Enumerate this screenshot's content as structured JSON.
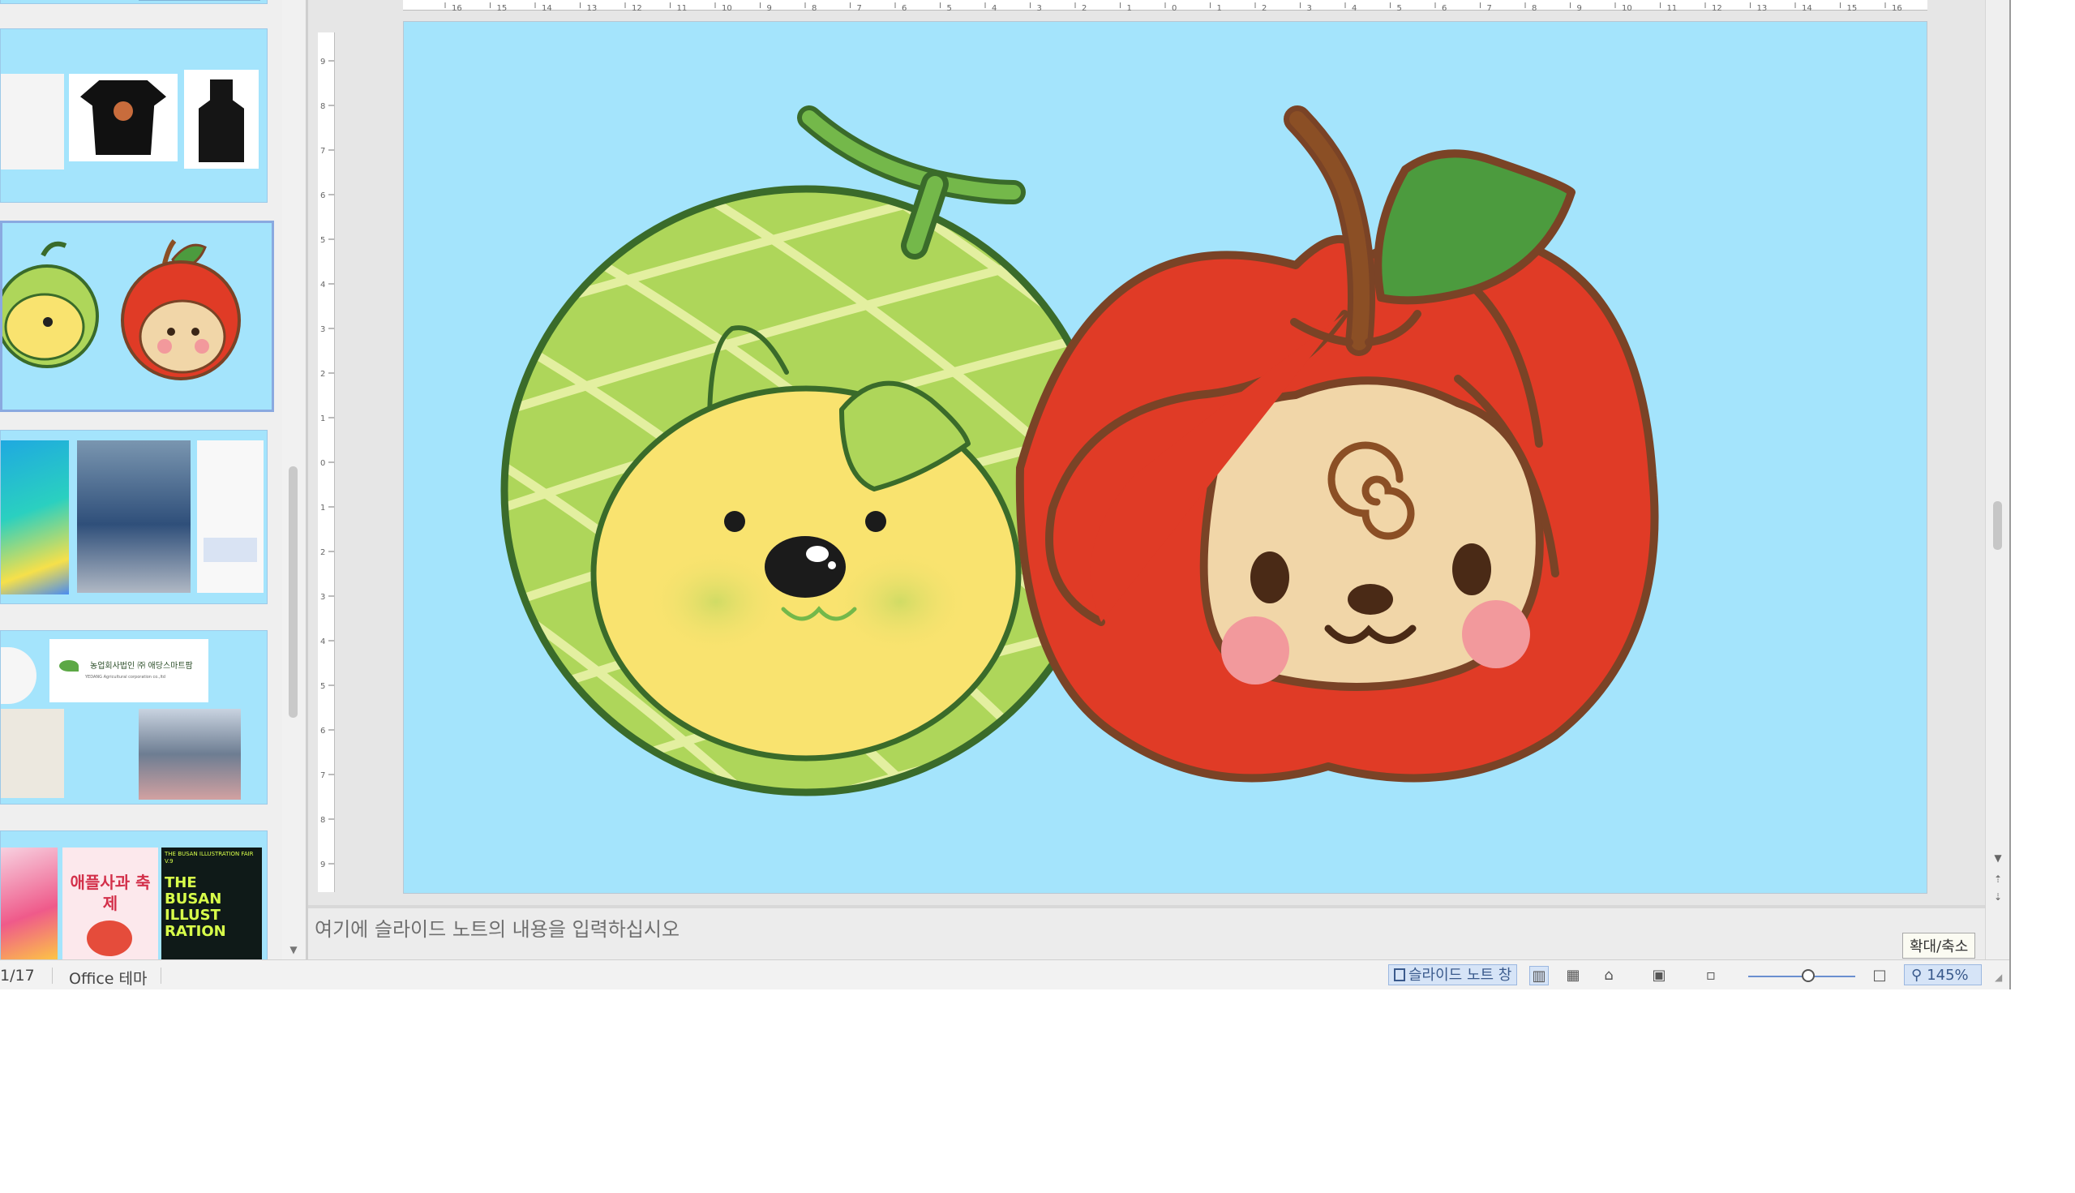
{
  "notes": {
    "placeholder": "여기에 슬라이드 노트의 내용을 입력하십시오"
  },
  "status_bar": {
    "slide_counter": "1/17",
    "theme": "Office 테마",
    "notes_button": "슬라이드 노트 창",
    "zoom_level": "145%"
  },
  "tooltip": {
    "text": "확대/축소"
  },
  "thumbnails": {
    "logo_title": "농업회사법인 ㈜ 애당스마트팜",
    "logo_subtitle": "YEDANG Agricultural corporation co.,ltd",
    "poster_festival": "애플사과 축제",
    "poster_illustration": "THE BUSAN ILLUST RATION",
    "poster_illustration_header": "THE BUSAN ILLUSTRATION FAIR V.9"
  },
  "colors": {
    "slide_bg": "#a4e4fc",
    "melon_light": "#aed65a",
    "melon_dark": "#3a6b2a",
    "melon_net": "#e3efa0",
    "face_yellow": "#f9e36f",
    "apple_red": "#e03b26",
    "apple_outline": "#7a4326",
    "stem_brown": "#8b4f25",
    "leaf_green": "#4c9b3e",
    "face_beige": "#f1d6a8",
    "cheek_pink": "#f2999c"
  },
  "icons": [
    "notes-icon",
    "normal-view-icon",
    "slide-sorter-icon",
    "reading-view-icon",
    "slideshow-icon",
    "fit-icon",
    "zoom-icon"
  ]
}
